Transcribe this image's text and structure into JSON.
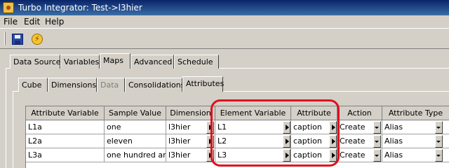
{
  "window": {
    "title": "Turbo Integrator:  Test->l3hier"
  },
  "menu": {
    "items": [
      "File",
      "Edit",
      "Help"
    ]
  },
  "toolbar": {
    "icons": [
      "save-icon",
      "execute-icon"
    ]
  },
  "main_tabs": [
    {
      "label": "Data Source"
    },
    {
      "label": "Variables"
    },
    {
      "label": "Maps"
    },
    {
      "label": "Advanced"
    },
    {
      "label": "Schedule"
    }
  ],
  "active_main_tab": "Maps",
  "sub_tabs": [
    {
      "label": "Cube"
    },
    {
      "label": "Dimensions"
    },
    {
      "label": "Data"
    },
    {
      "label": "Consolidations"
    },
    {
      "label": "Attributes"
    }
  ],
  "active_sub_tab": "Attributes",
  "disabled_sub_tab": "Data",
  "grid": {
    "columns": [
      "Attribute Variable",
      "Sample Value",
      "Dimension",
      "Element Variable",
      "Attribute",
      "Action",
      "Attribute Type"
    ],
    "rows": [
      {
        "attribute_variable": "L1a",
        "sample_value": "one",
        "dimension": "l3hier",
        "element_variable": "L1",
        "attribute": "caption",
        "action": "Create",
        "attribute_type": "Alias"
      },
      {
        "attribute_variable": "L2a",
        "sample_value": "eleven",
        "dimension": "l3hier",
        "element_variable": "L2",
        "attribute": "caption",
        "action": "Create",
        "attribute_type": "Alias"
      },
      {
        "attribute_variable": "L3a",
        "sample_value": "one hundred and",
        "dimension": "l3hier",
        "element_variable": "L3",
        "attribute": "caption",
        "action": "Create",
        "attribute_type": "Alias"
      }
    ]
  },
  "colors": {
    "highlight": "#e0101e",
    "title_bar": "#0a246a"
  }
}
